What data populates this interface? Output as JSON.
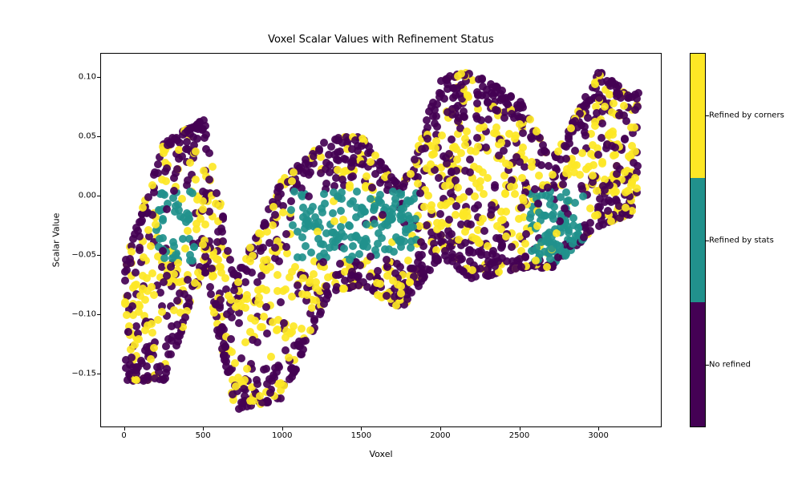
{
  "chart_data": {
    "type": "scatter",
    "title": "Voxel Scalar Values with Refinement Status",
    "xlabel": "Voxel",
    "ylabel": "Scalar Value",
    "xlim": [
      -150,
      3400
    ],
    "ylim": [
      -0.195,
      0.12
    ],
    "xticks": [
      0,
      500,
      1000,
      1500,
      2000,
      2500,
      3000
    ],
    "yticks": [
      -0.15,
      -0.1,
      -0.05,
      0.0,
      0.05,
      0.1
    ],
    "ytick_labels": [
      "−0.15",
      "−0.10",
      "−0.05",
      "0.00",
      "0.05",
      "0.10"
    ],
    "colorbar": {
      "labels": [
        "No refined",
        "Refined by stats",
        "Refined by corners"
      ],
      "label_positions": [
        0,
        1,
        2
      ],
      "range": [
        -0.5,
        2.5
      ],
      "colors": [
        "#440154",
        "#21918c",
        "#fde725"
      ]
    },
    "series_note": "Approx 3300 voxel indices on x; y from about -0.18 to 0.11; color encodes refinement category (0,1,2). Exact per-point values not legible; dense jittered vertical bands whose envelope trends upward with periodic dips.",
    "approx_envelope": [
      {
        "x": 0,
        "ymin": -0.155,
        "ymax": -0.055
      },
      {
        "x": 250,
        "ymin": -0.155,
        "ymax": 0.045
      },
      {
        "x": 500,
        "ymin": -0.06,
        "ymax": 0.065
      },
      {
        "x": 700,
        "ymin": -0.18,
        "ymax": -0.07
      },
      {
        "x": 1000,
        "ymin": -0.17,
        "ymax": 0.015
      },
      {
        "x": 1300,
        "ymin": -0.08,
        "ymax": 0.05
      },
      {
        "x": 1500,
        "ymin": -0.075,
        "ymax": 0.05
      },
      {
        "x": 1750,
        "ymin": -0.095,
        "ymax": 0.005
      },
      {
        "x": 2000,
        "ymin": -0.05,
        "ymax": 0.1
      },
      {
        "x": 2200,
        "ymin": -0.07,
        "ymax": 0.105
      },
      {
        "x": 2500,
        "ymin": -0.06,
        "ymax": 0.08
      },
      {
        "x": 2700,
        "ymin": -0.06,
        "ymax": 0.03
      },
      {
        "x": 3000,
        "ymin": -0.025,
        "ymax": 0.105
      },
      {
        "x": 3200,
        "ymin": -0.015,
        "ymax": 0.085
      }
    ],
    "category_bias_note": "Teal (Refined by stats) concentrates around mid-y band roughly -0.05 to 0.00 at x≈300, 1100-1800, 2600-2800; purple (No refined) tends toward local extremes; yellow (Refined by corners) spread throughout."
  },
  "colors": {
    "purple": "#440154",
    "teal": "#21918c",
    "yellow": "#fde725"
  }
}
